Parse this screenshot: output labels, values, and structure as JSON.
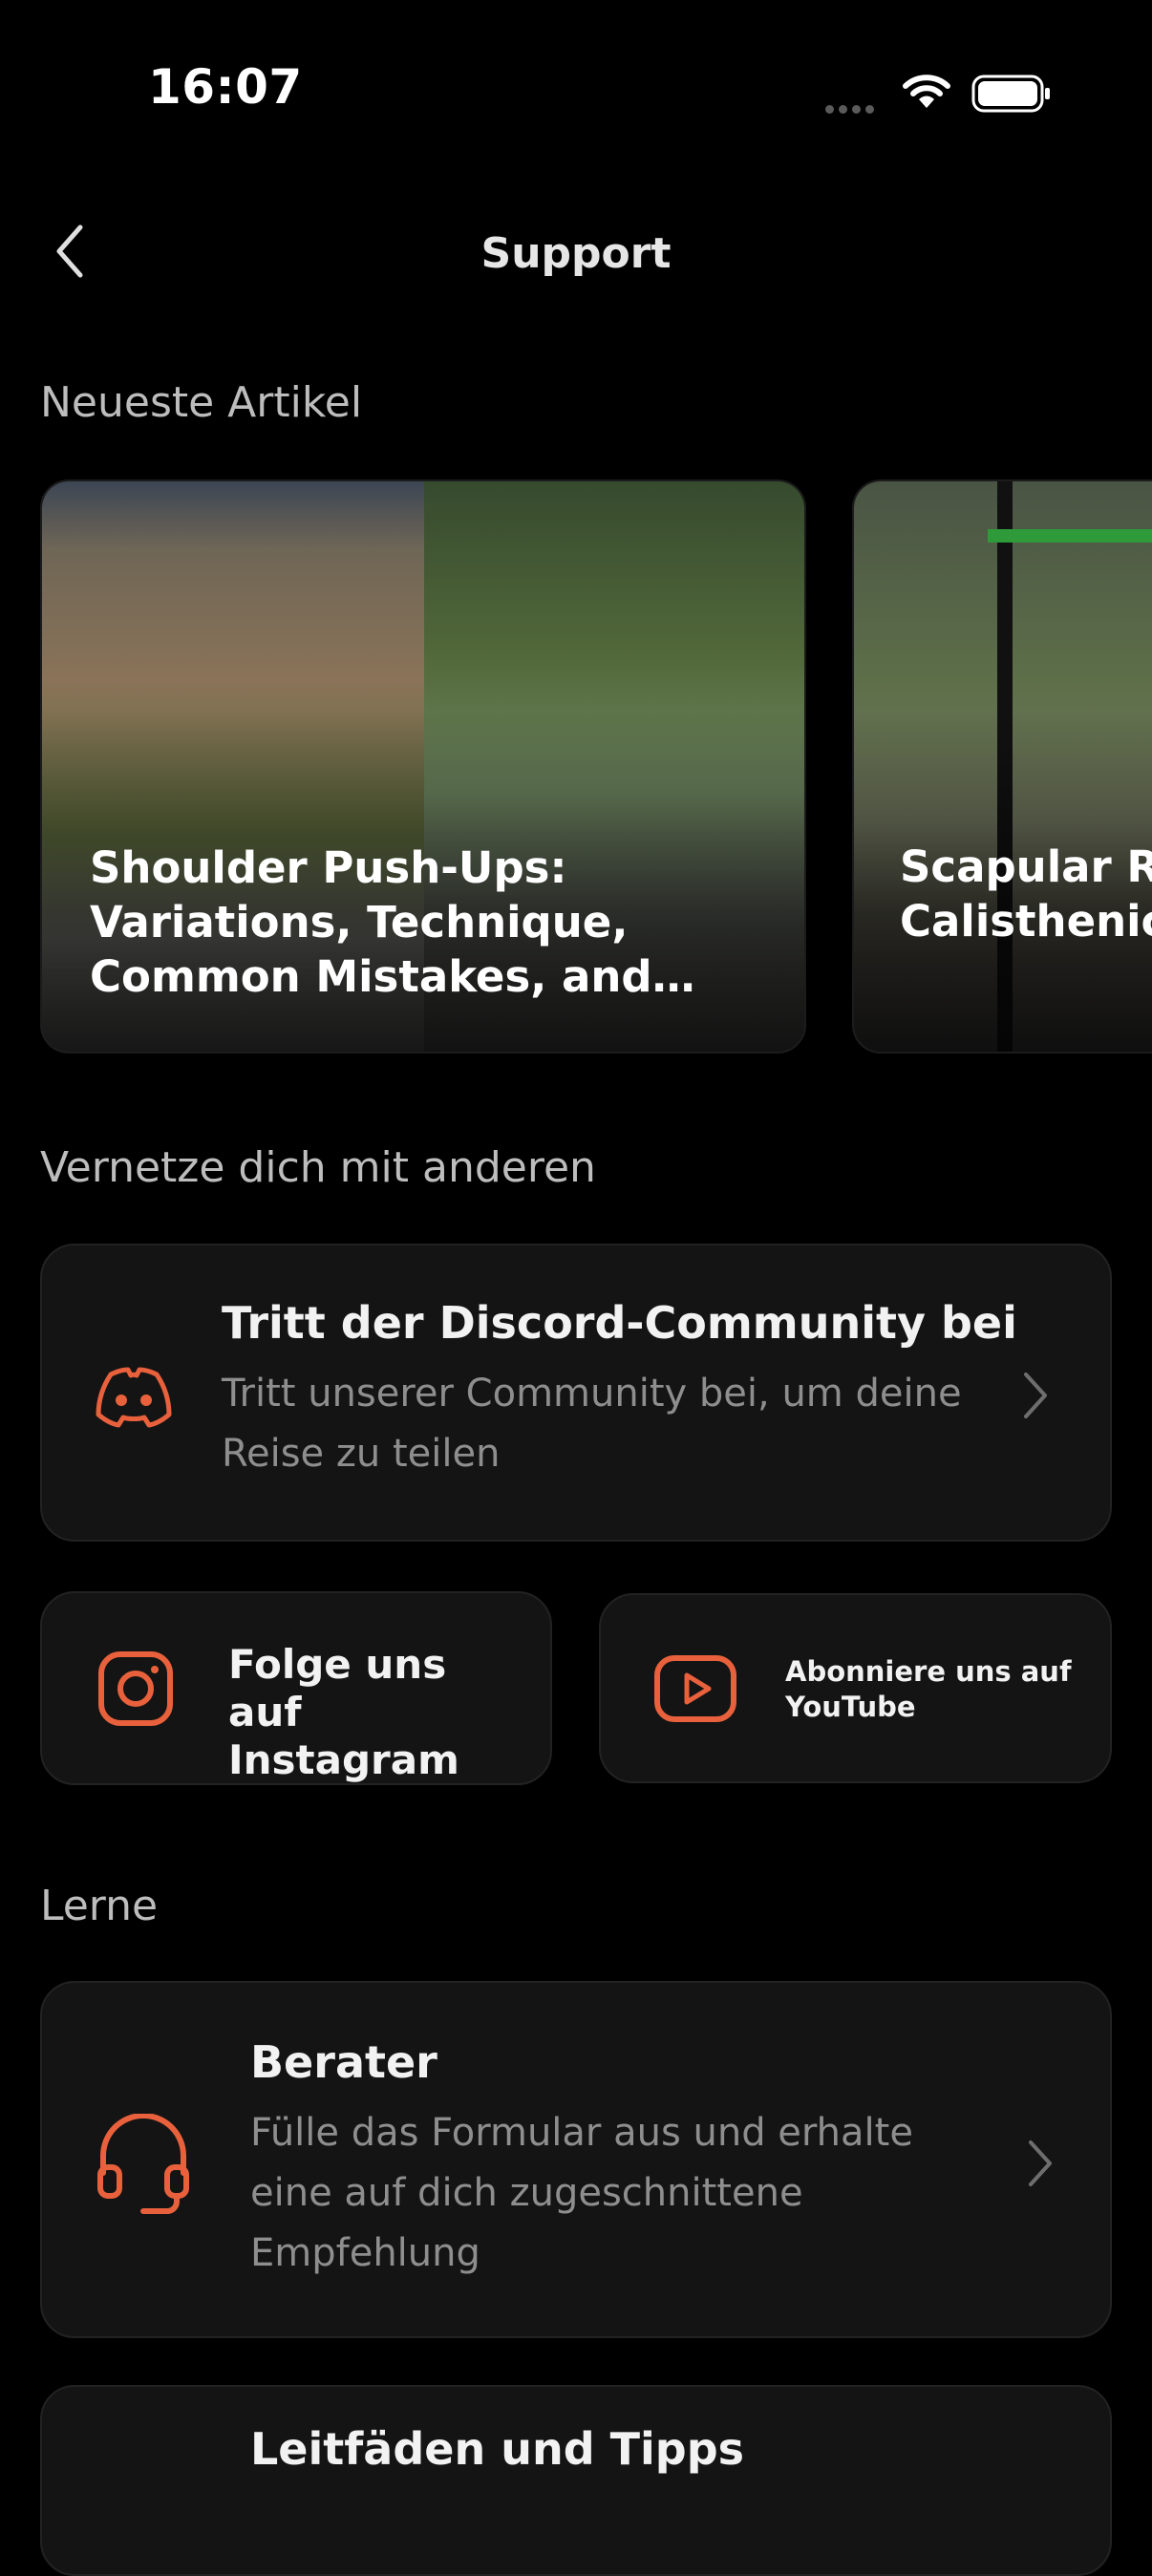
{
  "status_bar": {
    "time": "16:07"
  },
  "header": {
    "title": "Support"
  },
  "sections": {
    "articles": "Neueste Artikel",
    "connect": "Vernetze dich mit anderen",
    "learn": "Lerne"
  },
  "articles": [
    {
      "title": "Shoulder Push-Ups: Variations, Technique, Common Mistakes, and Progressions"
    },
    {
      "title": "Scapular Retractions in Calisthenics"
    }
  ],
  "discord": {
    "title": "Tritt der Discord-Community bei",
    "description": "Tritt unserer Community bei, um deine Reise zu teilen",
    "icon": "discord-icon"
  },
  "instagram": {
    "label": "Folge uns auf Instagram",
    "icon": "instagram-icon"
  },
  "youtube": {
    "label": "Abonniere uns auf YouTube",
    "icon": "youtube-icon"
  },
  "berater": {
    "title": "Berater",
    "description": "Fülle das Formular aus und erhalte eine auf dich zugeschnittene Empfehlung",
    "icon": "headset-icon"
  },
  "guides": {
    "title": "Leitfäden und Tipps"
  },
  "colors": {
    "background": "#000000",
    "card": "#141414",
    "accent": "#E8613C",
    "muted_text": "#8E8E8E"
  }
}
